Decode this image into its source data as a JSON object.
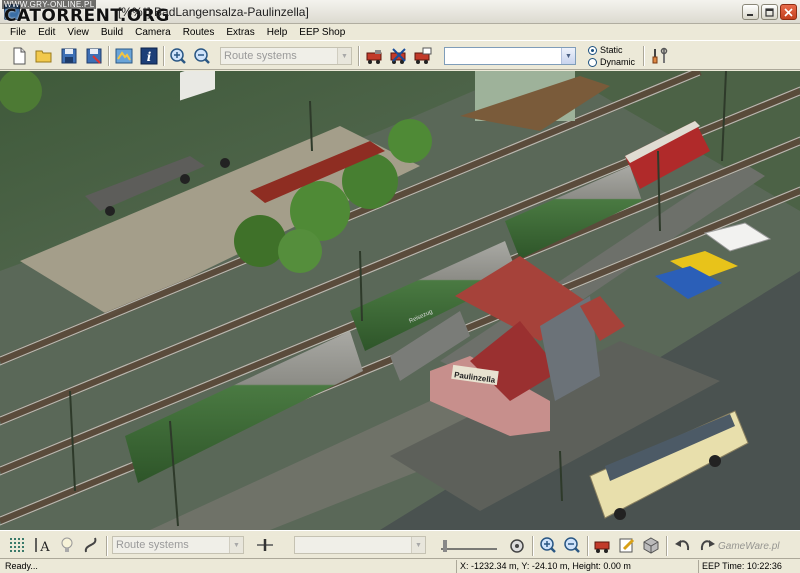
{
  "window": {
    "title": "[%%*] BadLangensalza-Paulinzella]",
    "watermark_site": "WWW.GRY-ONLINE.PL",
    "watermark_brand": "CATORRENT.ORG",
    "watermark_bottom": "GameWare.pl"
  },
  "menu": [
    "File",
    "Edit",
    "View",
    "Build",
    "Camera",
    "Routes",
    "Extras",
    "Help",
    "EEP Shop"
  ],
  "toolbar": {
    "route_select": "Route systems",
    "object_select": "",
    "camera_mode": {
      "options": [
        "Static",
        "Dynamic"
      ],
      "selected": "Static"
    }
  },
  "bottombar": {
    "route_select": "Route systems",
    "object_select": ""
  },
  "scene": {
    "station_sign": "Paulinzella",
    "coach_lettering": "Reisezug"
  },
  "status": {
    "ready": "Ready...",
    "coordinates": "X: -1232.34 m, Y: -24.10 m, Height: 0.00 m",
    "eep_time": "EEP Time: 10:22:36"
  },
  "colors": {
    "grass": "#5f6c5a",
    "gravel": "#8e887a",
    "locomotive": "#b02a2a",
    "coach": "#3c6a36",
    "station_roof": "#9a3030",
    "bus": "#e8dfac"
  }
}
